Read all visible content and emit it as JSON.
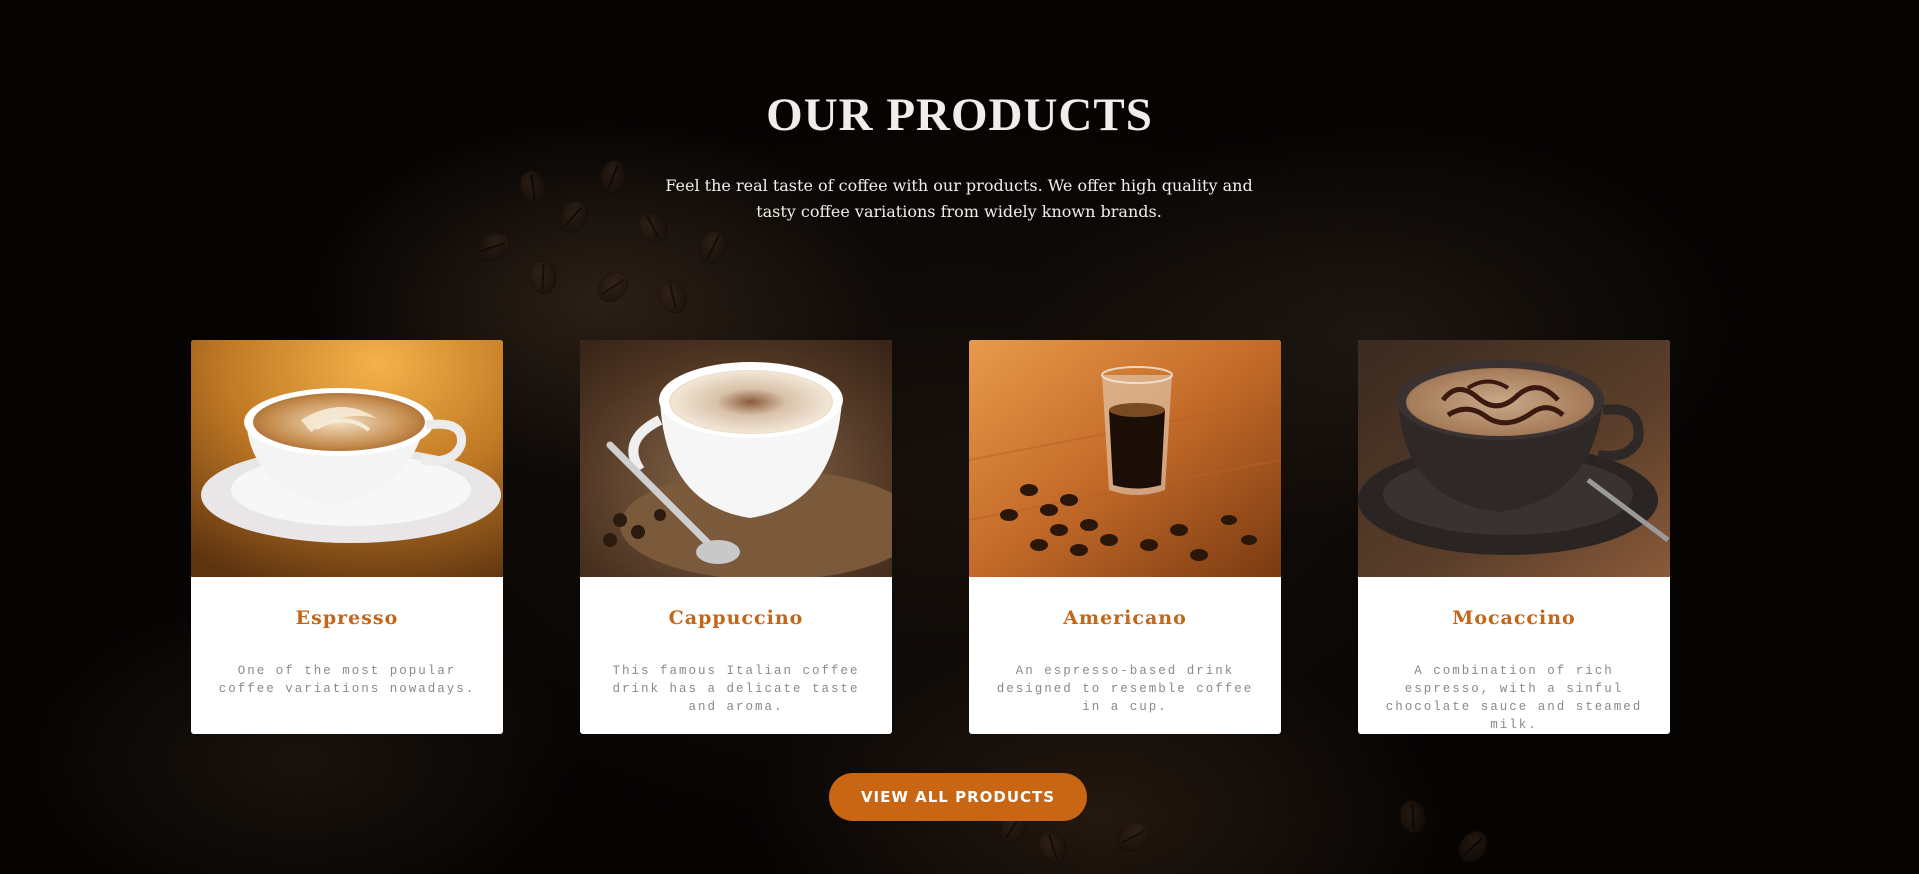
{
  "section": {
    "title": "OUR PRODUCTS",
    "intro": "Feel the real taste of coffee with our products. We offer high quality and tasty coffee variations from widely known brands."
  },
  "products": [
    {
      "name": "Espresso",
      "description": "One of the most popular coffee variations nowadays."
    },
    {
      "name": "Cappuccino",
      "description": "This famous Italian coffee drink has a delicate taste and aroma."
    },
    {
      "name": "Americano",
      "description": "An espresso-based drink designed to resemble coffee in a cup."
    },
    {
      "name": "Mocaccino",
      "description": "A combination of rich espresso, with a sinful chocolate sauce and steamed milk."
    }
  ],
  "cta": {
    "label": "VIEW ALL PRODUCTS"
  },
  "colors": {
    "accent": "#c96614",
    "title_accent": "#c4661a",
    "background": "#070504",
    "card": "#ffffff"
  }
}
